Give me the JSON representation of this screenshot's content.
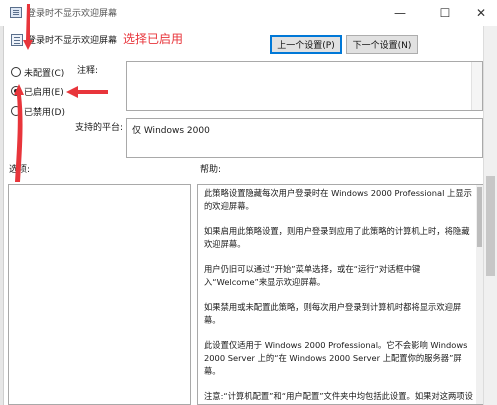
{
  "window": {
    "title": "登录时不显示欢迎屏幕",
    "controls": {
      "minimize": "—",
      "maximize": "☐",
      "close": "✕"
    }
  },
  "header": {
    "setting_name": "登录时不显示欢迎屏幕",
    "annotation": "选择已启用",
    "prev_button": "上一个设置(P)",
    "next_button": "下一个设置(N)"
  },
  "state": {
    "options": [
      {
        "label": "未配置(C)",
        "checked": false
      },
      {
        "label": "已启用(E)",
        "checked": true
      },
      {
        "label": "已禁用(D)",
        "checked": false
      }
    ]
  },
  "fields": {
    "comment_label": "注释:",
    "comment_value": "",
    "supported_label": "支持的平台:",
    "supported_value": "仅 Windows 2000"
  },
  "panes": {
    "options_label": "选项:",
    "help_label": "帮助:",
    "help_paragraphs": [
      "此策略设置隐藏每次用户登录时在 Windows 2000 Professional 上显示的欢迎屏幕。",
      "如果启用此策略设置，则用户登录到应用了此策略的计算机上时，将隐藏欢迎屏幕。",
      "用户仍旧可以通过“开始”菜单选择，或在“运行”对话框中键入“Welcome”来显示欢迎屏幕。",
      "如果禁用或未配置此策略，则每次用户登录到计算机时都将显示欢迎屏幕。",
      "此设置仅适用于 Windows 2000 Professional。它不会影响 Windows 2000 Server 上的“在 Windows 2000 Server 上配置你的服务器”屏幕。",
      "注意:“计算机配置”和“用户配置”文件夹中均包括此设置。如果对这两项设置都进行了配置，则“计算机配置”中的设置优先于“用户配置”"
    ]
  },
  "colors": {
    "annotation": "#e8353b",
    "focus": "#0078d7"
  }
}
